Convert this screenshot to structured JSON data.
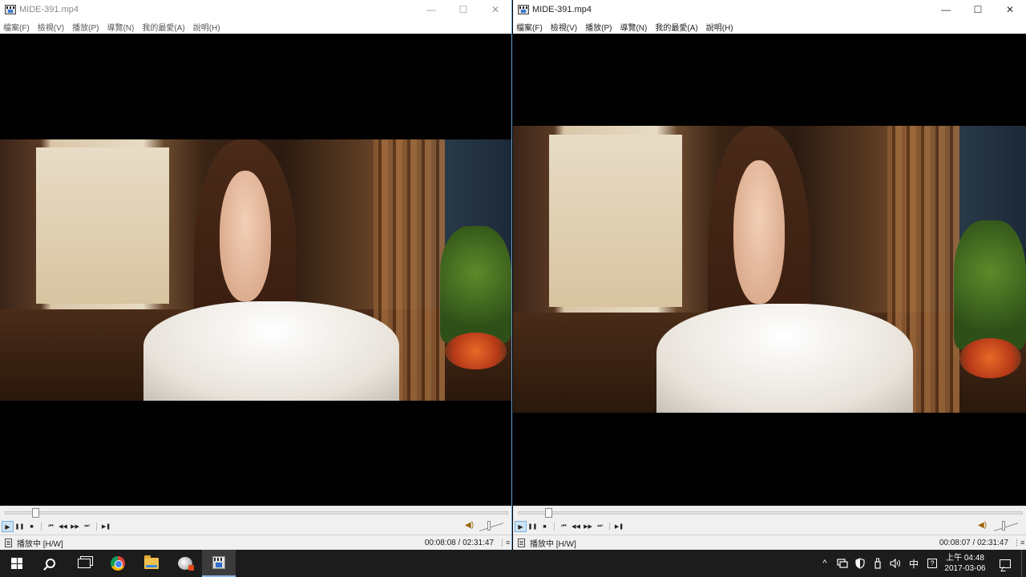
{
  "windows": [
    {
      "title": "MIDE-391.mp4",
      "menu": [
        "檔案(F)",
        "檢視(V)",
        "播放(P)",
        "導覽(N)",
        "我的最愛(A)",
        "說明(H)"
      ],
      "status": "播放中 [H/W]",
      "time": "00:08:08 / 02:31:47",
      "seek_fraction": 0.054
    },
    {
      "title": "MIDE-391.mp4",
      "menu": [
        "檔案(F)",
        "檢視(V)",
        "播放(P)",
        "導覽(N)",
        "我的最愛(A)",
        "說明(H)"
      ],
      "status": "播放中 [H/W]",
      "time": "00:08:07 / 02:31:47",
      "seek_fraction": 0.054
    }
  ],
  "window_controls": {
    "minimize": "—",
    "maximize": "☐",
    "close": "✕"
  },
  "player_buttons": {
    "play": "▶",
    "pause": "❚❚",
    "stop": "■",
    "prev": "⏮",
    "rewind": "◀◀",
    "forward": "▶▶",
    "next": "⏭",
    "frame_step": "▶❚",
    "volume": "◀)"
  },
  "taskbar": {
    "apps": [
      "windows-start",
      "search",
      "task-view",
      "chrome",
      "file-explorer",
      "app",
      "mpc-hc"
    ],
    "tray": {
      "chevron": "^",
      "ime": "中",
      "ime_box": "?"
    },
    "clock_time": "上午 04:48",
    "clock_date": "2017-03-06"
  }
}
